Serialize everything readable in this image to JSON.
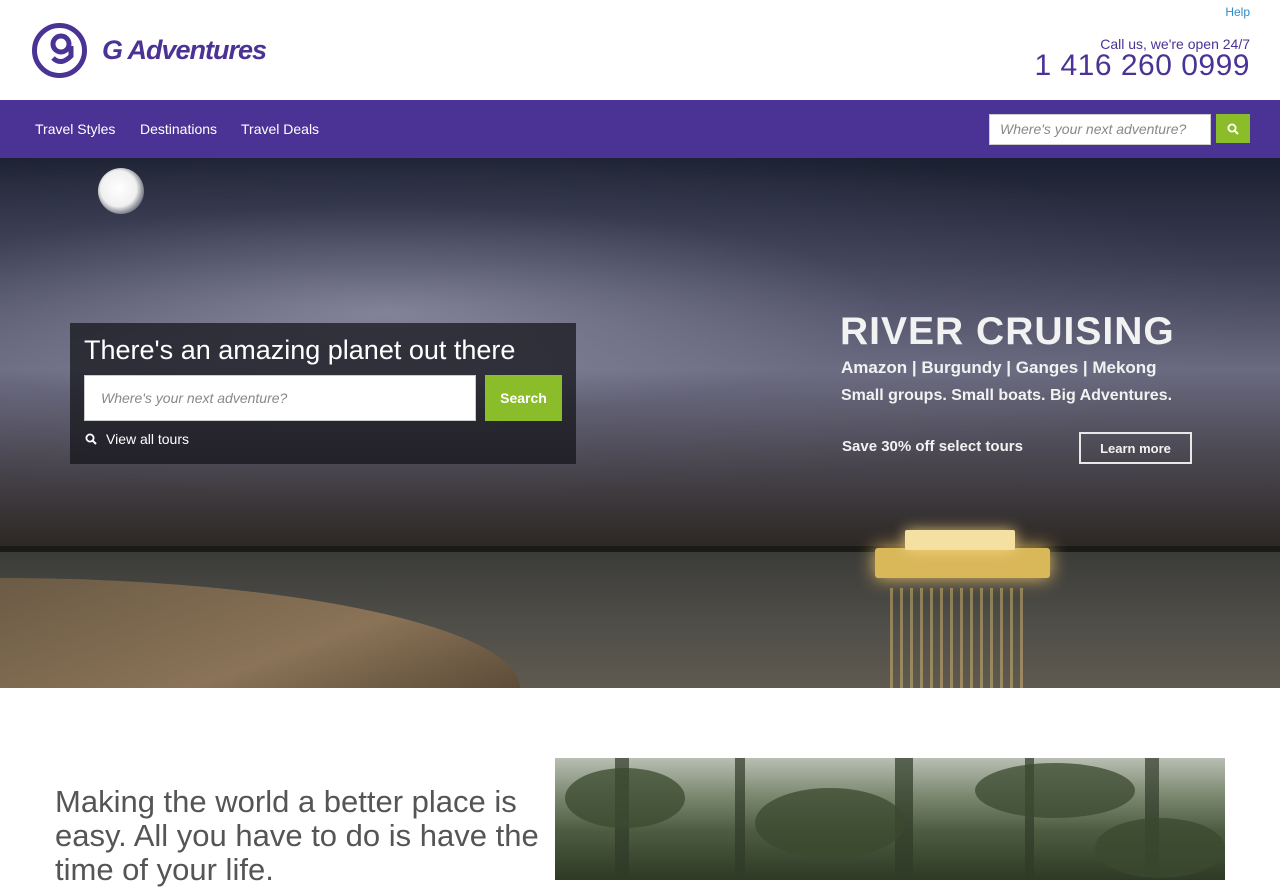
{
  "header": {
    "brand": "G Adventures",
    "help_label": "Help",
    "call_text": "Call us, we're open 24/7",
    "phone": "1 416 260 0999"
  },
  "nav": {
    "items": [
      {
        "label": "Travel Styles"
      },
      {
        "label": "Destinations"
      },
      {
        "label": "Travel Deals"
      }
    ],
    "search_placeholder": "Where's your next adventure?"
  },
  "hero": {
    "title": "There's an amazing planet out there",
    "search_placeholder": "Where's your next adventure?",
    "search_button": "Search",
    "view_all_label": "View all tours",
    "promo": {
      "title": "RIVER CRUISING",
      "destinations": "Amazon | Burgundy | Ganges | Mekong",
      "tagline": "Small groups. Small boats. Big Adventures.",
      "offer": "Save 30% off select tours",
      "cta": "Learn more"
    }
  },
  "section": {
    "tagline": "Making the world a better place is easy. All you have to do is have the time of your life."
  },
  "colors": {
    "brand_purple": "#4b3295",
    "accent_green": "#8bbd2b",
    "link_blue": "#2c8dc7"
  }
}
